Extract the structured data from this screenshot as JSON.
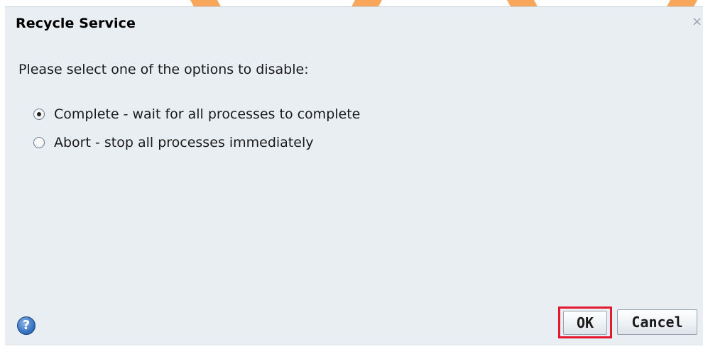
{
  "dialog": {
    "title": "Recycle Service",
    "close_glyph": "×",
    "prompt": "Please select one of the options to disable:",
    "options": [
      {
        "label": "Complete - wait for all processes to complete",
        "selected": true
      },
      {
        "label": "Abort - stop all processes immediately",
        "selected": false
      }
    ],
    "help_glyph": "?",
    "ok_label": "OK",
    "cancel_label": "Cancel"
  },
  "icons": {
    "close": "close-icon",
    "help": "help-icon",
    "radio": "radio-icon"
  },
  "colors": {
    "dialog_background": "#e9eef3",
    "ok_highlight": "#e3182c",
    "watermark_stripes": "#f7a65a"
  }
}
